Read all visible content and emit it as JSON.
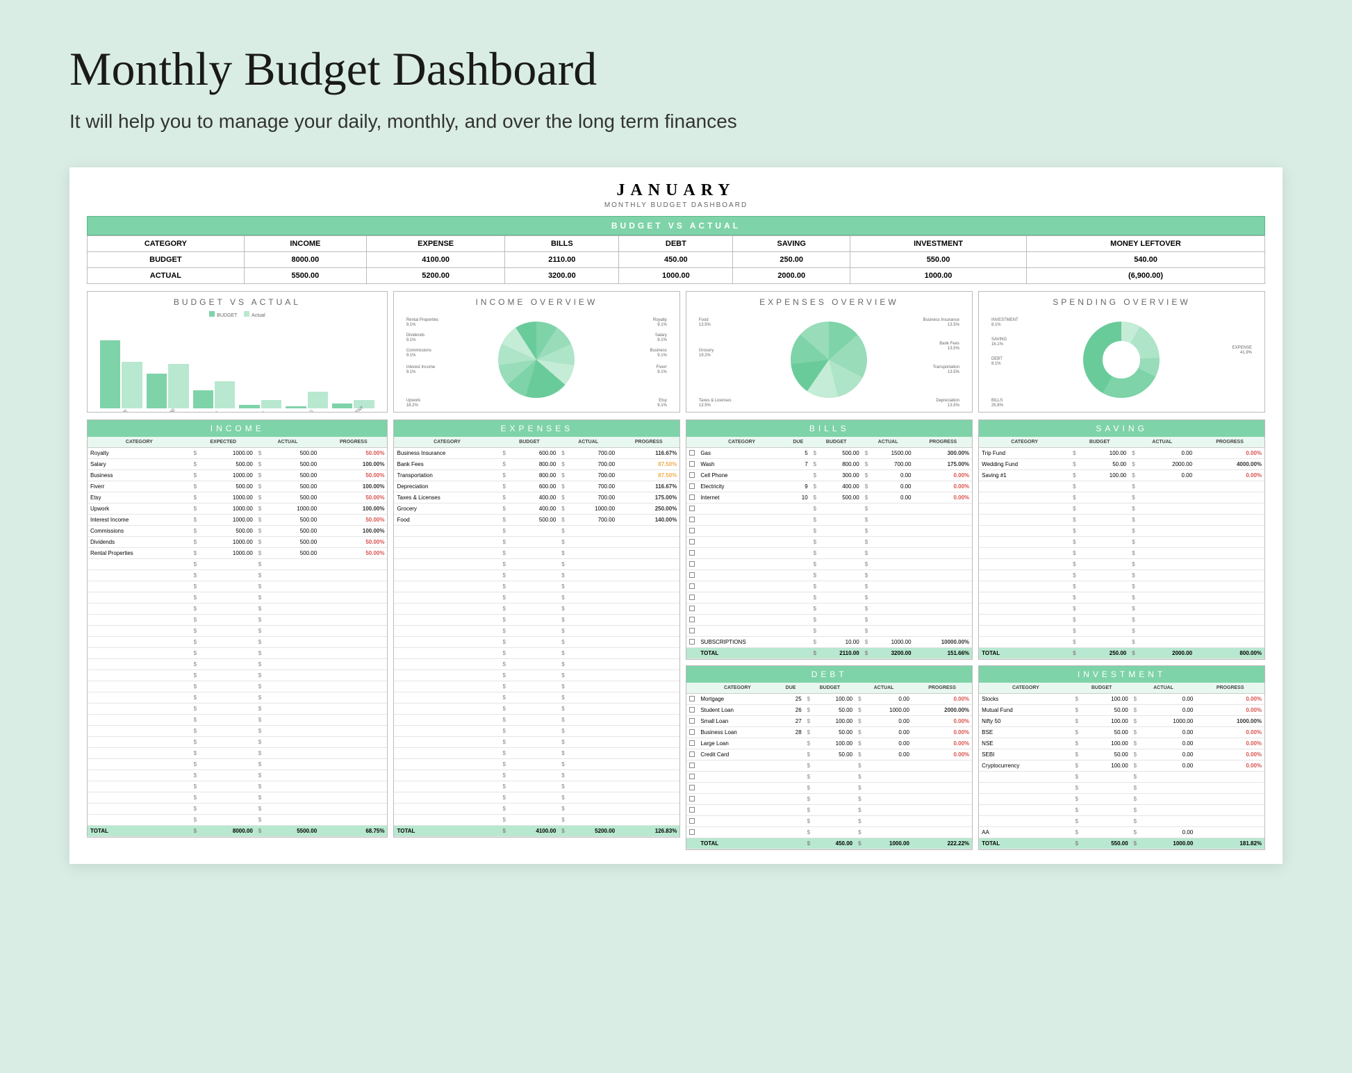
{
  "hero": {
    "title": "Monthly Budget Dashboard",
    "subtitle": "It will help you to manage your daily, monthly, and over the long term finances"
  },
  "month": "JANUARY",
  "month_sub": "MONTHLY BUDGET DASHBOARD",
  "bva_header": "BUDGET VS ACTUAL",
  "summary": {
    "headers": [
      "CATEGORY",
      "INCOME",
      "EXPENSE",
      "BILLS",
      "DEBT",
      "SAVING",
      "INVESTMENT",
      "MONEY LEFTOVER"
    ],
    "budget_label": "BUDGET",
    "actual_label": "ACTUAL",
    "budget": [
      "8000.00",
      "4100.00",
      "2110.00",
      "450.00",
      "250.00",
      "550.00",
      "540.00"
    ],
    "actual": [
      "5500.00",
      "5200.00",
      "3200.00",
      "1000.00",
      "2000.00",
      "1000.00",
      "(6,900.00)"
    ]
  },
  "chart_data": [
    {
      "type": "bar",
      "title": "BUDGET VS ACTUAL",
      "categories": [
        "INCOME",
        "EXPENSE",
        "BILLS",
        "DEBT",
        "SAVING",
        "INVESTMENT"
      ],
      "series": [
        {
          "name": "BUDGET",
          "values": [
            8000,
            4100,
            2110,
            450,
            250,
            550
          ]
        },
        {
          "name": "Actual",
          "values": [
            5500,
            5200,
            3200,
            1000,
            2000,
            1000
          ]
        }
      ],
      "ylim": [
        0,
        9000
      ]
    },
    {
      "type": "pie",
      "title": "INCOME OVERVIEW",
      "labels": [
        "Rental Properties",
        "Dividends",
        "Commissions",
        "Interest Income",
        "Upwork",
        "Etsy",
        "Fiverr",
        "Business",
        "Salary",
        "Royalty"
      ],
      "values": [
        9.1,
        9.1,
        9.1,
        9.1,
        18.2,
        9.1,
        9.1,
        9.1,
        9.1,
        9.1
      ]
    },
    {
      "type": "pie",
      "title": "EXPENSES OVERVIEW",
      "labels": [
        "Food",
        "Grocery",
        "Taxes & Licenses",
        "Depreciation",
        "Transportation",
        "Bank Fees",
        "Business Insurance"
      ],
      "values": [
        13.5,
        19.2,
        13.5,
        13.5,
        13.5,
        13.5,
        13.5
      ]
    },
    {
      "type": "pie",
      "title": "SPENDING OVERVIEW",
      "labels": [
        "INVESTMENT",
        "SAVING",
        "DEBT",
        "BILLS",
        "EXPENSE"
      ],
      "values": [
        8.1,
        16.1,
        8.1,
        25.8,
        41.9
      ]
    }
  ],
  "sections": {
    "income": {
      "title": "INCOME",
      "headers": [
        "CATEGORY",
        "EXPECTED",
        "ACTUAL",
        "PROGRESS"
      ],
      "rows": [
        [
          "Royalty",
          "1000.00",
          "500.00",
          "50.00%",
          "red"
        ],
        [
          "Salary",
          "500.00",
          "500.00",
          "100.00%",
          "green"
        ],
        [
          "Business",
          "1000.00",
          "500.00",
          "50.00%",
          "red"
        ],
        [
          "Fiverr",
          "500.00",
          "500.00",
          "100.00%",
          "green"
        ],
        [
          "Etsy",
          "1000.00",
          "500.00",
          "50.00%",
          "red"
        ],
        [
          "Upwork",
          "1000.00",
          "1000.00",
          "100.00%",
          "green"
        ],
        [
          "Interest Income",
          "1000.00",
          "500.00",
          "50.00%",
          "red"
        ],
        [
          "Commissions",
          "500.00",
          "500.00",
          "100.00%",
          "green"
        ],
        [
          "Dividends",
          "1000.00",
          "500.00",
          "50.00%",
          "red"
        ],
        [
          "Rental Properties",
          "1000.00",
          "500.00",
          "50.00%",
          "red"
        ]
      ],
      "empty_rows": 24,
      "total": [
        "TOTAL",
        "8000.00",
        "5500.00",
        "68.75%"
      ]
    },
    "expenses": {
      "title": "EXPENSES",
      "headers": [
        "CATEGORY",
        "BUDGET",
        "ACTUAL",
        "PROGRESS"
      ],
      "rows": [
        [
          "Business Insurance",
          "600.00",
          "700.00",
          "116.67%",
          "green"
        ],
        [
          "Bank Fees",
          "800.00",
          "700.00",
          "87.50%",
          "orange"
        ],
        [
          "Transportation",
          "800.00",
          "700.00",
          "87.50%",
          "orange"
        ],
        [
          "Depreciation",
          "600.00",
          "700.00",
          "116.67%",
          "green"
        ],
        [
          "Taxes & Licenses",
          "400.00",
          "700.00",
          "175.00%",
          "green"
        ],
        [
          "Grocery",
          "400.00",
          "1000.00",
          "250.00%",
          "green"
        ],
        [
          "Food",
          "500.00",
          "700.00",
          "140.00%",
          "green"
        ]
      ],
      "empty_rows": 27,
      "total": [
        "TOTAL",
        "4100.00",
        "5200.00",
        "126.83%"
      ]
    },
    "bills": {
      "title": "BILLS",
      "headers": [
        "",
        "CATEGORY",
        "DUE",
        "BUDGET",
        "ACTUAL",
        "PROGRESS"
      ],
      "rows": [
        [
          "Gas",
          "5",
          "500.00",
          "1500.00",
          "300.00%",
          "green"
        ],
        [
          "Wash",
          "7",
          "800.00",
          "700.00",
          "175.00%",
          "green"
        ],
        [
          "Cell Phone",
          "",
          "300.00",
          "0.00",
          "0.00%",
          "red"
        ],
        [
          "Electricity",
          "9",
          "400.00",
          "0.00",
          "0.00%",
          "red"
        ],
        [
          "Internet",
          "10",
          "500.00",
          "0.00",
          "0.00%",
          "red"
        ]
      ],
      "empty_rows": 12,
      "last_row": [
        "SUBSCRIPTIONS",
        "",
        "10.00",
        "1000.00",
        "10000.00%",
        "green"
      ],
      "total": [
        "TOTAL",
        "",
        "2110.00",
        "3200.00",
        "151.66%"
      ]
    },
    "debt": {
      "title": "DEBT",
      "headers": [
        "",
        "CATEGORY",
        "DUE",
        "BUDGET",
        "ACTUAL",
        "PROGRESS"
      ],
      "rows": [
        [
          "Mortgage",
          "25",
          "100.00",
          "0.00",
          "0.00%",
          "red"
        ],
        [
          "Student Loan",
          "26",
          "50.00",
          "1000.00",
          "2000.00%",
          "green"
        ],
        [
          "Small Loan",
          "27",
          "100.00",
          "0.00",
          "0.00%",
          "red"
        ],
        [
          "Business Loan",
          "28",
          "50.00",
          "0.00",
          "0.00%",
          "red"
        ],
        [
          "Large Loan",
          "",
          "100.00",
          "0.00",
          "0.00%",
          "red"
        ],
        [
          "Credit Card",
          "",
          "50.00",
          "0.00",
          "0.00%",
          "red"
        ]
      ],
      "empty_rows": 7,
      "total": [
        "TOTAL",
        "",
        "450.00",
        "1000.00",
        "222.22%"
      ]
    },
    "saving": {
      "title": "SAVING",
      "headers": [
        "CATEGORY",
        "BUDGET",
        "ACTUAL",
        "PROGRESS"
      ],
      "rows": [
        [
          "Trip Fund",
          "100.00",
          "0.00",
          "0.00%",
          "red"
        ],
        [
          "Wedding Fund",
          "50.00",
          "2000.00",
          "4000.00%",
          "green"
        ],
        [
          "Saving #1",
          "100.00",
          "0.00",
          "0.00%",
          "red"
        ]
      ],
      "empty_rows": 15,
      "total": [
        "TOTAL",
        "250.00",
        "2000.00",
        "800.00%"
      ]
    },
    "investment": {
      "title": "INVESTMENT",
      "headers": [
        "CATEGORY",
        "BUDGET",
        "ACTUAL",
        "PROGRESS"
      ],
      "rows": [
        [
          "Stocks",
          "100.00",
          "0.00",
          "0.00%",
          "red"
        ],
        [
          "Mutual Fund",
          "50.00",
          "0.00",
          "0.00%",
          "red"
        ],
        [
          "Nifty 50",
          "100.00",
          "1000.00",
          "1000.00%",
          "green"
        ],
        [
          "BSE",
          "50.00",
          "0.00",
          "0.00%",
          "red"
        ],
        [
          "NSE",
          "100.00",
          "0.00",
          "0.00%",
          "red"
        ],
        [
          "SEBI",
          "50.00",
          "0.00",
          "0.00%",
          "red"
        ],
        [
          "Cryptocurrency",
          "100.00",
          "0.00",
          "0.00%",
          "red"
        ]
      ],
      "empty_rows": 5,
      "last_row": [
        "AA",
        "",
        "0.00",
        "",
        ""
      ],
      "total": [
        "TOTAL",
        "550.00",
        "1000.00",
        "181.82%"
      ]
    }
  }
}
